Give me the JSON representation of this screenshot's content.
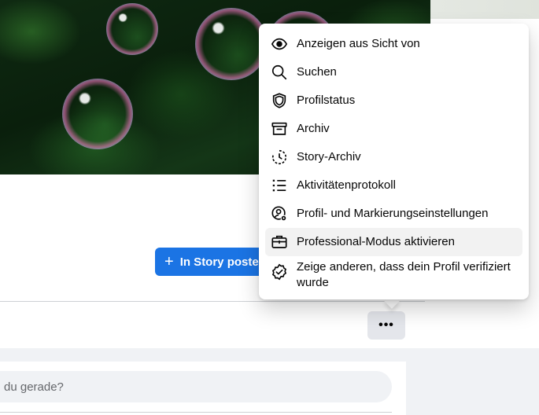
{
  "composer": {
    "placeholder_text": "du gerade?"
  },
  "story_button": {
    "label": "In Story posten"
  },
  "more_button": {
    "label": "•••"
  },
  "menu": {
    "items": [
      {
        "label": "Anzeigen aus Sicht von",
        "icon": "eye-icon"
      },
      {
        "label": "Suchen",
        "icon": "search-icon"
      },
      {
        "label": "Profilstatus",
        "icon": "shield-icon"
      },
      {
        "label": "Archiv",
        "icon": "archive-box-icon"
      },
      {
        "label": "Story-Archiv",
        "icon": "story-archive-clock-icon"
      },
      {
        "label": "Aktivitätenprotokoll",
        "icon": "list-icon"
      },
      {
        "label": "Profil- und Markierungseinstellungen",
        "icon": "profile-gear-icon"
      },
      {
        "label": "Professional-Modus aktivieren",
        "icon": "briefcase-icon"
      },
      {
        "label": "Zeige anderen, dass dein Profil verifiziert wurde",
        "icon": "verified-badge-icon"
      }
    ]
  },
  "colors": {
    "primary_button": "#1b74e4",
    "menu_highlight": "#f2f2f2",
    "secondary_button": "#e4e6eb"
  }
}
